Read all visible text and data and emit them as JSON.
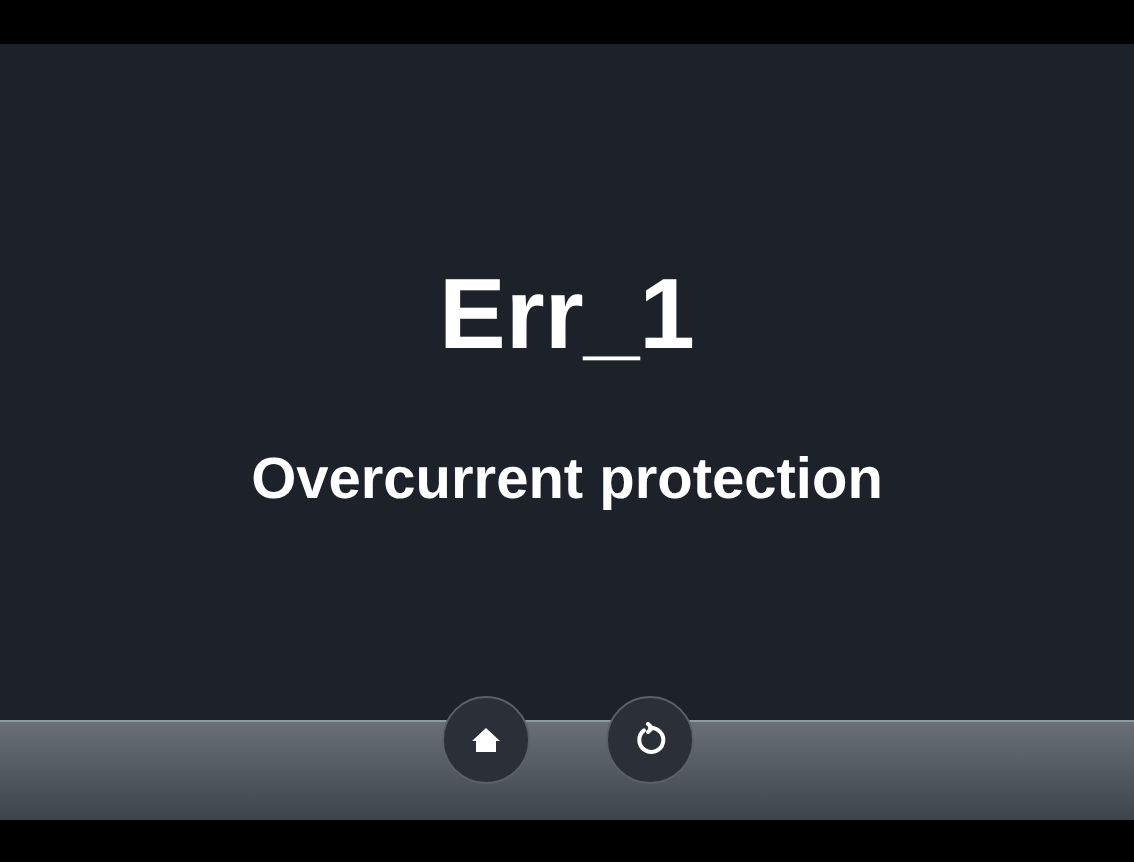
{
  "error": {
    "code": "Err_1",
    "message": "Overcurrent protection"
  },
  "toolbar": {
    "buttons": [
      {
        "kind": "home"
      },
      {
        "kind": "refresh"
      }
    ]
  }
}
